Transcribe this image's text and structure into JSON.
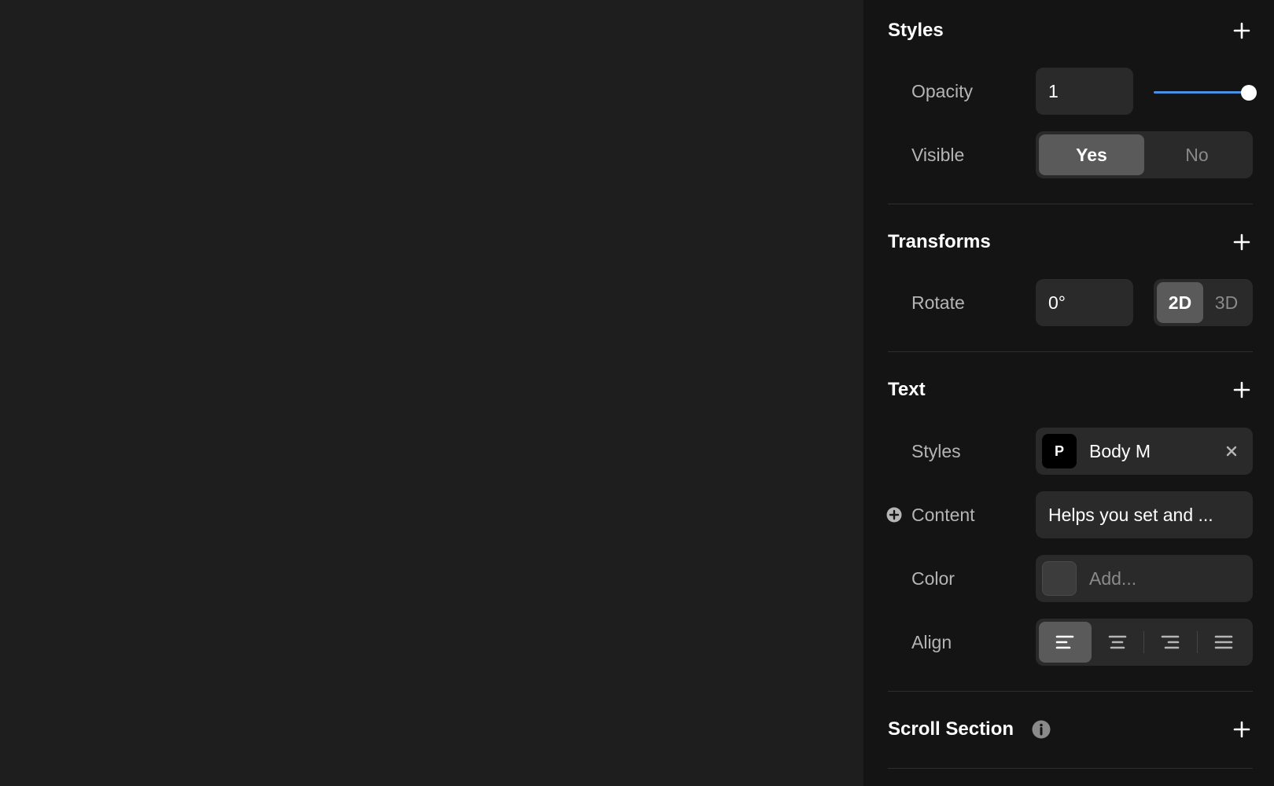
{
  "styles_section": {
    "title": "Styles",
    "opacity_label": "Opacity",
    "opacity_value": "1",
    "opacity_slider_fraction": 1.0,
    "visible_label": "Visible",
    "visible_options": [
      "Yes",
      "No"
    ],
    "visible_selected": "Yes"
  },
  "transforms_section": {
    "title": "Transforms",
    "rotate_label": "Rotate",
    "rotate_value": "0°",
    "mode_options": [
      "2D",
      "3D"
    ],
    "mode_selected": "2D"
  },
  "text_section": {
    "title": "Text",
    "styles_label": "Styles",
    "style_badge": "P",
    "style_name": "Body M",
    "content_label": "Content",
    "content_value": "Helps you set and ...",
    "color_label": "Color",
    "color_placeholder": "Add...",
    "align_label": "Align",
    "align_options": [
      "left",
      "center",
      "right",
      "justify"
    ],
    "align_selected": "left"
  },
  "scroll_section": {
    "title": "Scroll Section"
  },
  "icons": {
    "add": "plus-icon",
    "clear": "close-icon",
    "content_add": "plus-circle-icon",
    "info": "info-icon"
  },
  "colors": {
    "slider_accent": "#4a90e2",
    "panel_background": "#141414",
    "canvas_background": "#1e1e1e"
  }
}
